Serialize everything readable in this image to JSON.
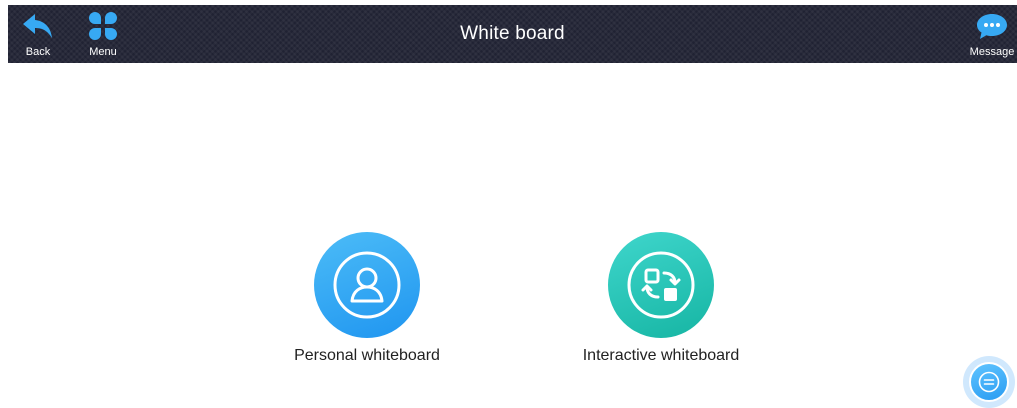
{
  "header": {
    "title": "White board",
    "back_label": "Back",
    "menu_label": "Menu",
    "message_label": "Message"
  },
  "options": [
    {
      "label": "Personal whiteboard",
      "icon": "person-icon"
    },
    {
      "label": "Interactive whiteboard",
      "icon": "sync-icon"
    }
  ],
  "floating_button": {
    "icon": "menu-lines-icon"
  },
  "colors": {
    "header_bg": "#202233",
    "accent_blue": "#1f95f0",
    "accent_teal": "#16b5a3",
    "icon_blue": "#37a9f3"
  }
}
